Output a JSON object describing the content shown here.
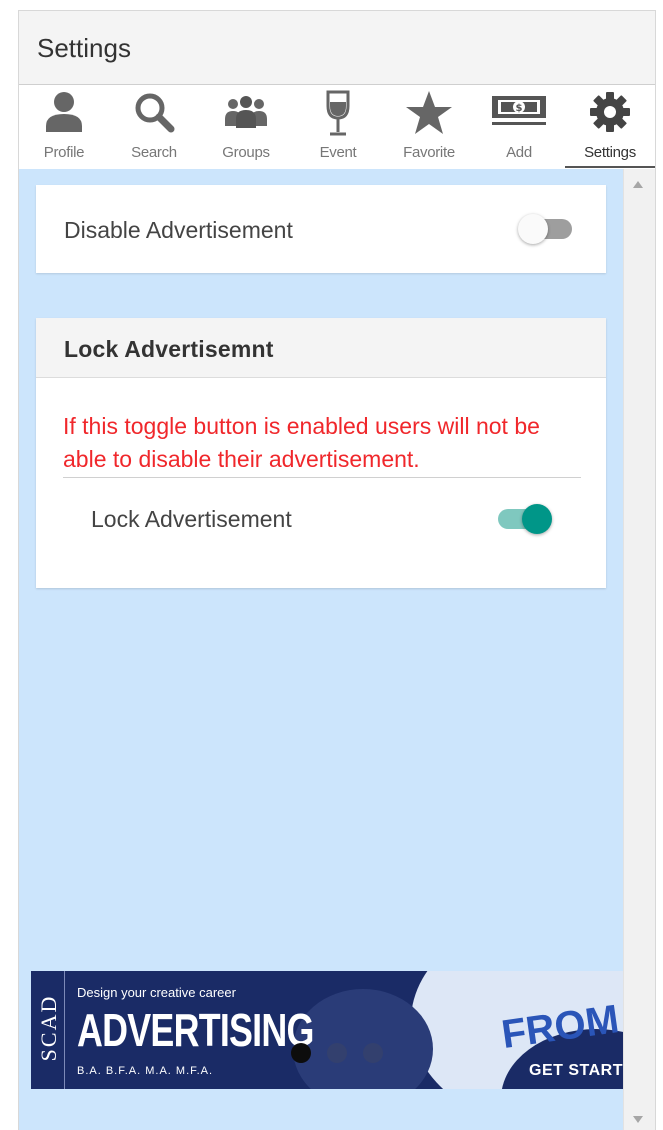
{
  "header": {
    "title": "Settings"
  },
  "tabs": [
    {
      "label": "Profile",
      "icon": "person-icon"
    },
    {
      "label": "Search",
      "icon": "search-icon"
    },
    {
      "label": "Groups",
      "icon": "groups-icon"
    },
    {
      "label": "Event",
      "icon": "wine-glass-icon"
    },
    {
      "label": "Favorite",
      "icon": "star-icon"
    },
    {
      "label": "Add",
      "icon": "dollar-bill-icon"
    },
    {
      "label": "Settings",
      "icon": "gear-icon",
      "active": true
    }
  ],
  "disable_card": {
    "label": "Disable Advertisement",
    "enabled": false
  },
  "lock_card": {
    "heading": "Lock Advertisemnt",
    "warning": "If this toggle button is enabled users will not be able to disable their advertisement.",
    "label": "Lock Advertisement",
    "enabled": true
  },
  "ad": {
    "brand": "SCAD",
    "tagline": "Design your creative career",
    "headline": "ADVERTISING",
    "degrees": "B.A.  B.F.A.  M.A.  M.F.A.",
    "artwork_text": "FROM",
    "cta": "GET STARTED"
  },
  "colors": {
    "content_bg": "#cce5fc",
    "toggle_on": "#009688",
    "warning_text": "#f0272b",
    "ad_bg": "#1a2b66"
  }
}
